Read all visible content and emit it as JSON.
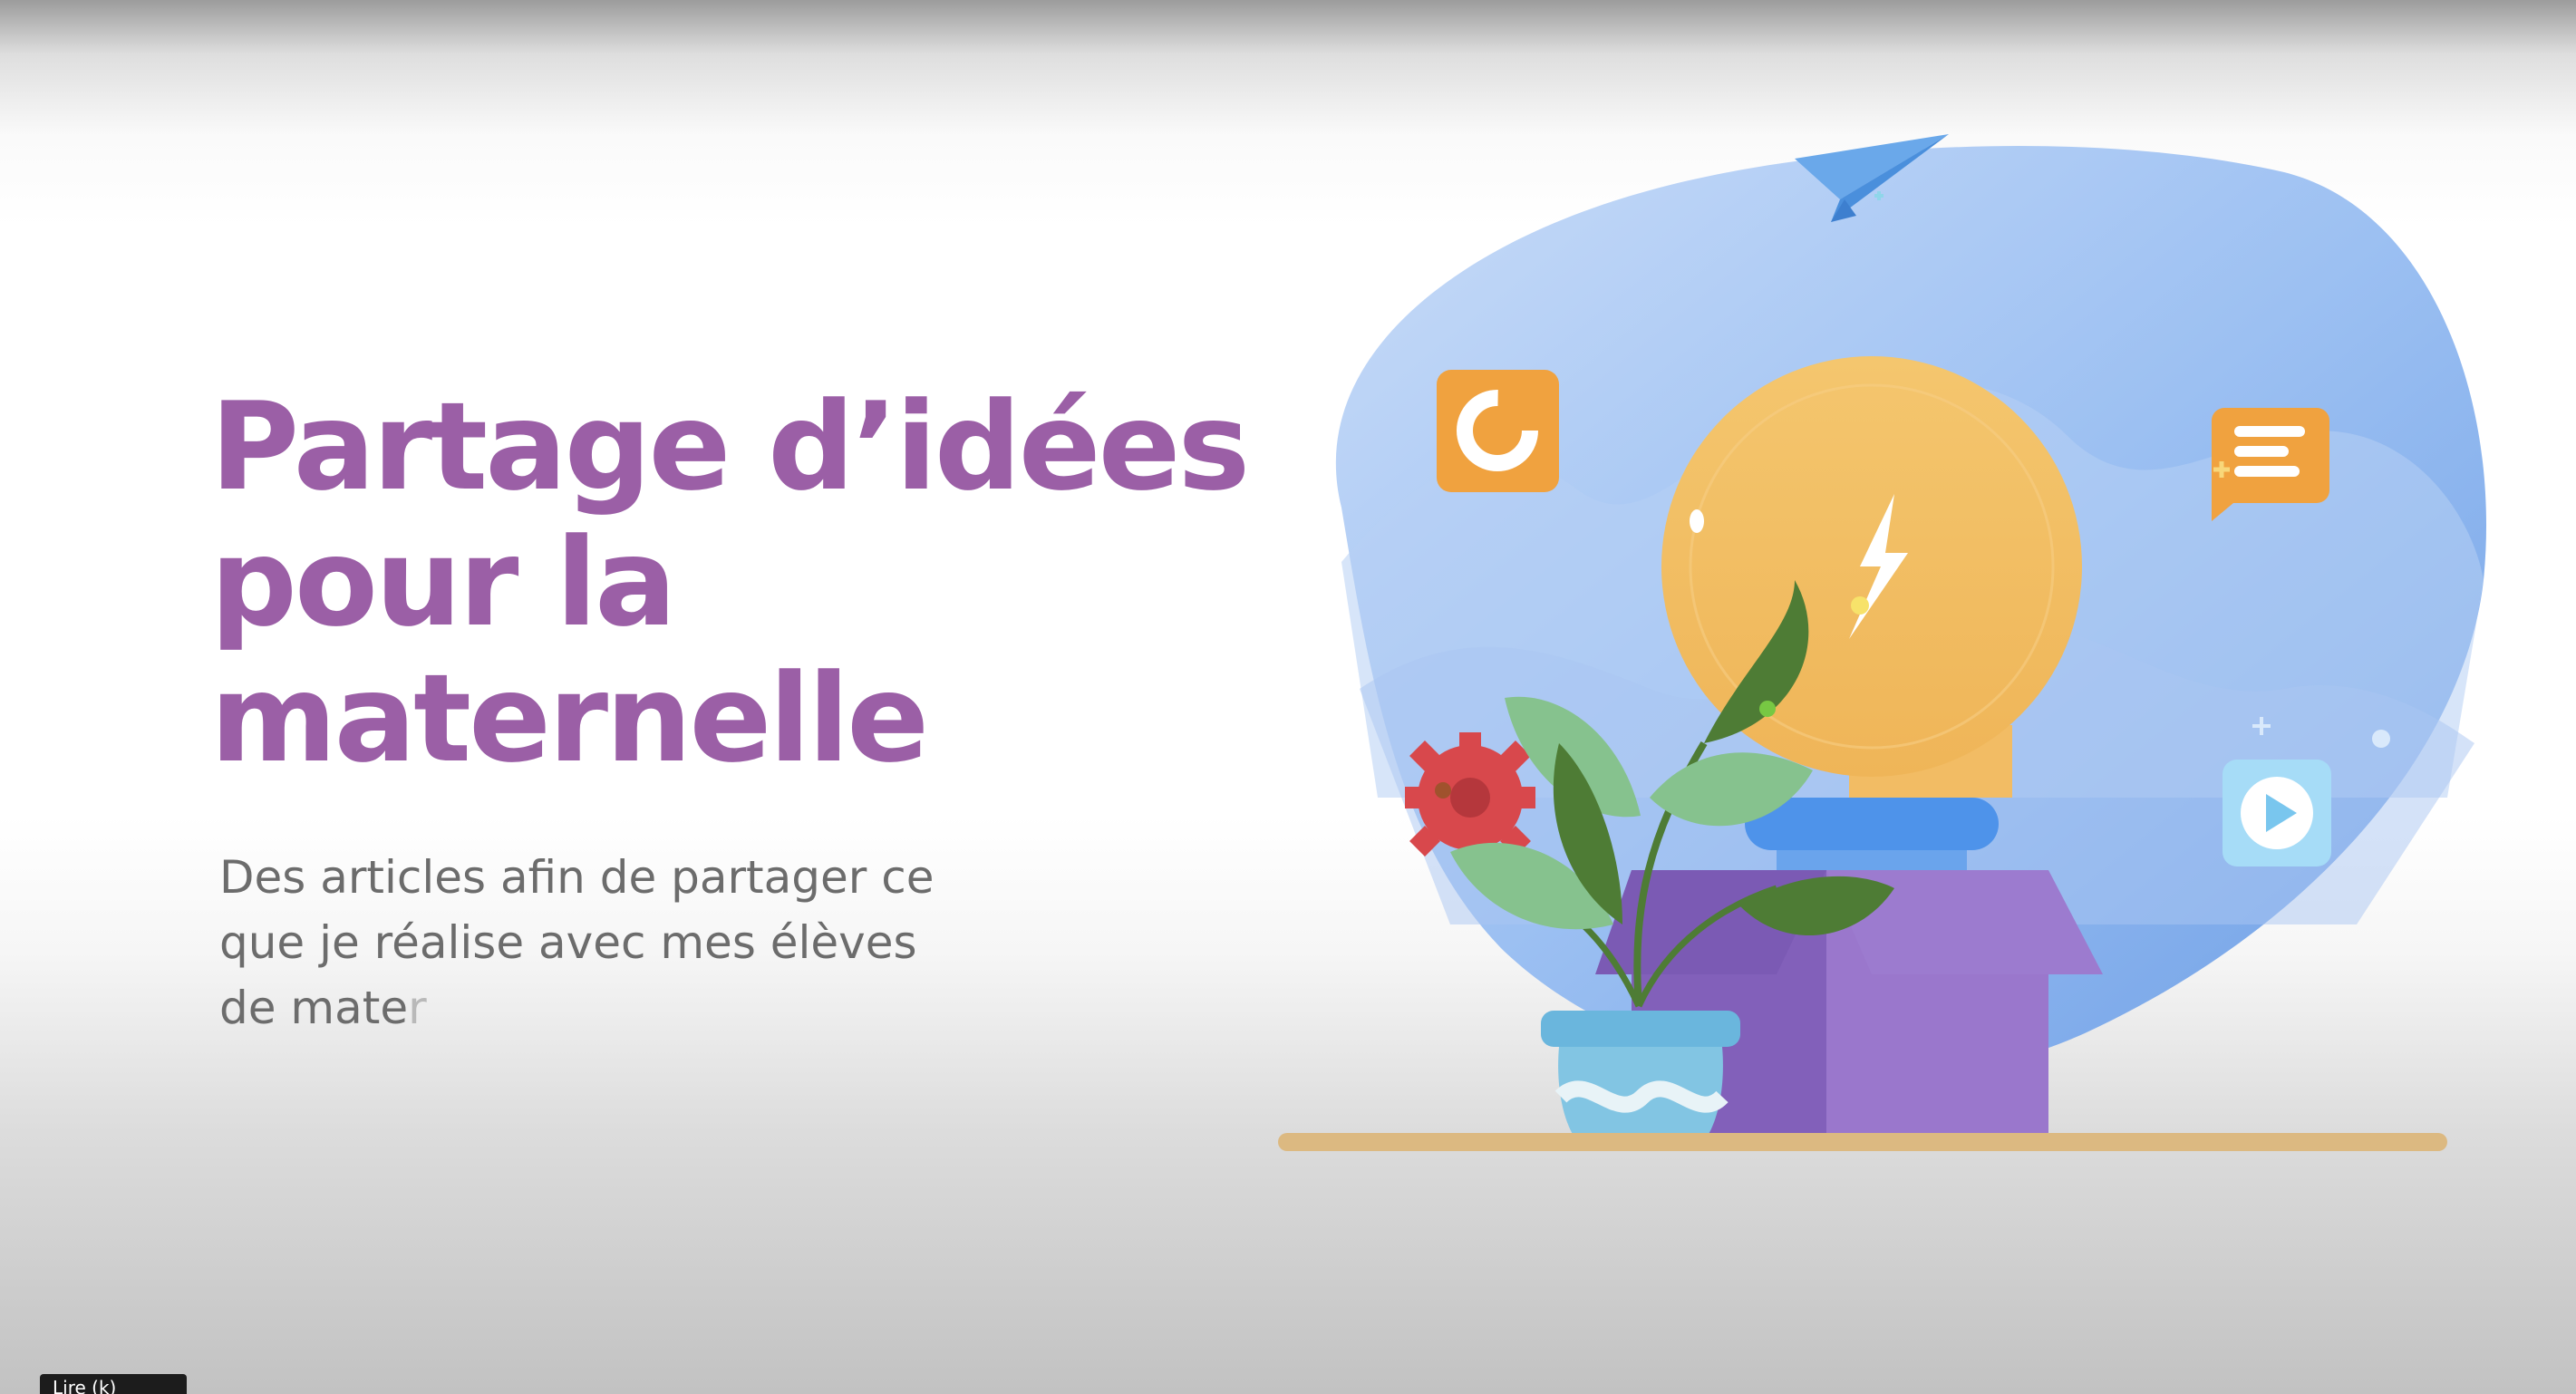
{
  "slide": {
    "title_lines": [
      "Partage d’idées",
      "pour la",
      "maternelle"
    ],
    "subtitle_lines": [
      "Des articles afin de partager ce",
      "que je réalise avec mes élèves"
    ],
    "subtitle_partial_visible": "de mate",
    "subtitle_partial_fading": "r"
  },
  "player": {
    "chip_label": "Lire (k)"
  },
  "illustration": {
    "icons": [
      "paper-plane-icon",
      "donut-chart-icon",
      "lightbulb-icon",
      "lightning-bolt-icon",
      "chat-bubble-icon",
      "play-icon",
      "gear-icon",
      "plant-icon",
      "box-icon"
    ]
  },
  "colors": {
    "title": "#9b5fa6",
    "subtitle": "#6c6c6c",
    "blob": "#8fb6f0",
    "bulb": "#f2bc64",
    "box": "#9b77cc",
    "orange_icon": "#f0a23f",
    "gear": "#d8484c",
    "plant_dark": "#4e7c35",
    "plant_light": "#86c28e",
    "pot": "#7ec3df",
    "shelf": "#dcb981"
  }
}
